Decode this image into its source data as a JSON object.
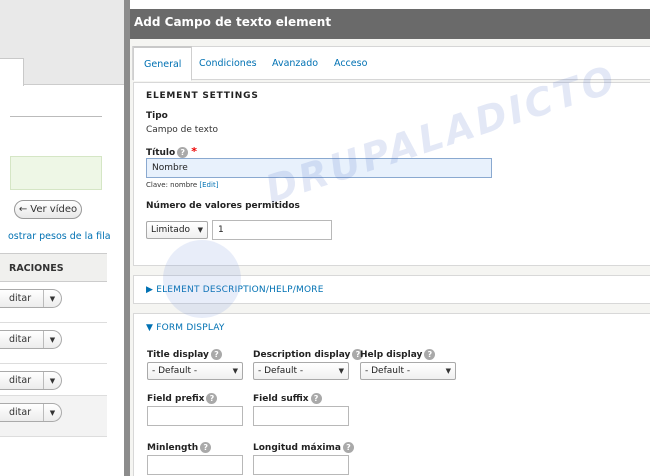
{
  "background_page": {
    "ver_video_label": "Ver vídeo",
    "row_weights_link": "ostrar pesos de la fila",
    "table_header": "RACIONES",
    "row_buttons": [
      "ditar",
      "ditar",
      "ditar",
      "ditar"
    ]
  },
  "dialog": {
    "title": "Add Campo de texto element",
    "tabs": [
      {
        "label": "General",
        "active": true
      },
      {
        "label": "Condiciones",
        "active": false
      },
      {
        "label": "Avanzado",
        "active": false
      },
      {
        "label": "Acceso",
        "active": false
      }
    ],
    "element_settings": {
      "heading": "ELEMENT SETTINGS",
      "type_label": "Tipo",
      "type_value": "Campo de texto",
      "title_label": "Título",
      "title_required_mark": "*",
      "title_value": "Nombre",
      "machine_name_prefix": "Clave: nombre",
      "machine_name_edit": "[Edit]",
      "allowed_values_label": "Número de valores permitidos",
      "allowed_values_select": "Limitado",
      "allowed_values_number": "1"
    },
    "description_section": "ELEMENT DESCRIPTION/HELP/MORE",
    "form_display": {
      "heading": "FORM DISPLAY",
      "title_display_label": "Title display",
      "title_display_value": "- Default -",
      "description_display_label": "Description display",
      "description_display_value": "- Default -",
      "help_display_label": "Help display",
      "help_display_value": "- Default -",
      "field_prefix_label": "Field prefix",
      "field_suffix_label": "Field suffix",
      "minlength_label": "Minlength",
      "maxlength_label": "Longitud máxima"
    }
  },
  "watermark_text": "DRUPALADICTO",
  "colors": {
    "link": "#0071b3",
    "titlebar": "#6a6a6a",
    "required": "#e00000",
    "focused_input": "#e8f1fc"
  }
}
